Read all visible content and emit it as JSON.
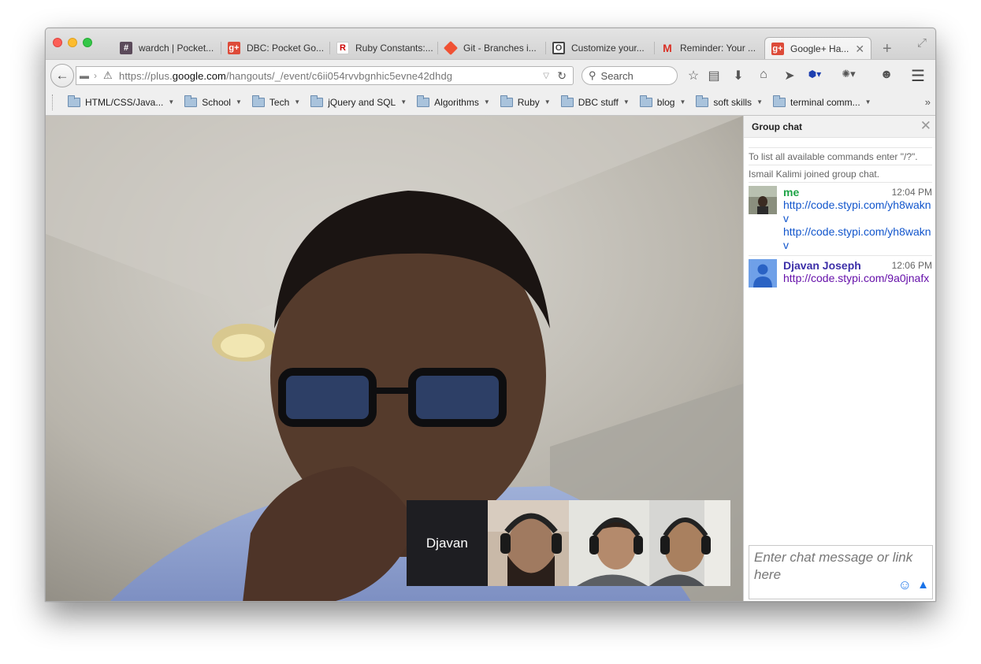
{
  "tabs": [
    {
      "label": "wardch | Pocket...",
      "favicon": "#",
      "fav_color": "#5b4a5a"
    },
    {
      "label": "DBC: Pocket Go...",
      "favicon": "g+",
      "fav_color": "#dd4b39"
    },
    {
      "label": "Ruby Constants:...",
      "favicon": "R",
      "fav_color": "#cc0000"
    },
    {
      "label": "Git - Branches i...",
      "favicon": "◆",
      "fav_color": "#f05133"
    },
    {
      "label": "Customize your...",
      "favicon": "O",
      "fav_color": "#444444"
    },
    {
      "label": "Reminder: Your ...",
      "favicon": "M",
      "fav_color": "#d93025"
    },
    {
      "label": "Google+ Ha...",
      "favicon": "g+",
      "fav_color": "#dd4b39",
      "active": true
    }
  ],
  "navbar": {
    "url_prefix": "https://plus.",
    "url_domain": "google.com",
    "url_path": "/hangouts/_/event/c6ii054rvvbgnhic5evne42dhdg",
    "search_placeholder": "Search"
  },
  "bookmarks": [
    {
      "label": "HTML/CSS/Java..."
    },
    {
      "label": "School"
    },
    {
      "label": "Tech"
    },
    {
      "label": "jQuery and SQL"
    },
    {
      "label": "Algorithms"
    },
    {
      "label": "Ruby"
    },
    {
      "label": "DBC stuff"
    },
    {
      "label": "blog"
    },
    {
      "label": "soft skills"
    },
    {
      "label": "terminal comm..."
    }
  ],
  "hangout": {
    "participant_name": "Djavan"
  },
  "chat": {
    "title": "Group chat",
    "system_messages": [
      "To list all available commands enter \"/?\".",
      "Ismail Kalimi joined group chat."
    ],
    "messages": [
      {
        "sender": "me",
        "time": "12:04 PM",
        "sender_color": "#1ea446",
        "links": [
          "http://code.stypi.com​/yh8waknv",
          "http://code.stypi.com​/yh8waknv"
        ]
      },
      {
        "sender": "Djavan Joseph",
        "time": "12:06 PM",
        "sender_color": "#3c2fa8",
        "links": [
          "http://code.stypi.com​/9a0jnafx"
        ]
      }
    ],
    "input_placeholder": "Enter chat message or link here"
  }
}
